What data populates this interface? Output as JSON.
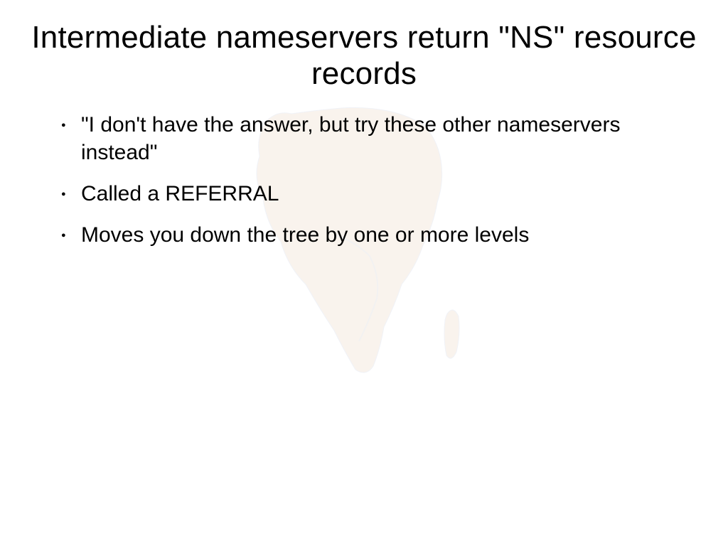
{
  "slide": {
    "title": "Intermediate nameservers return \"NS\" resource records",
    "bullets": [
      "\"I don't have the answer, but try these other nameservers instead\"",
      "Called a REFERRAL",
      "Moves you down the tree by one or more levels"
    ]
  }
}
